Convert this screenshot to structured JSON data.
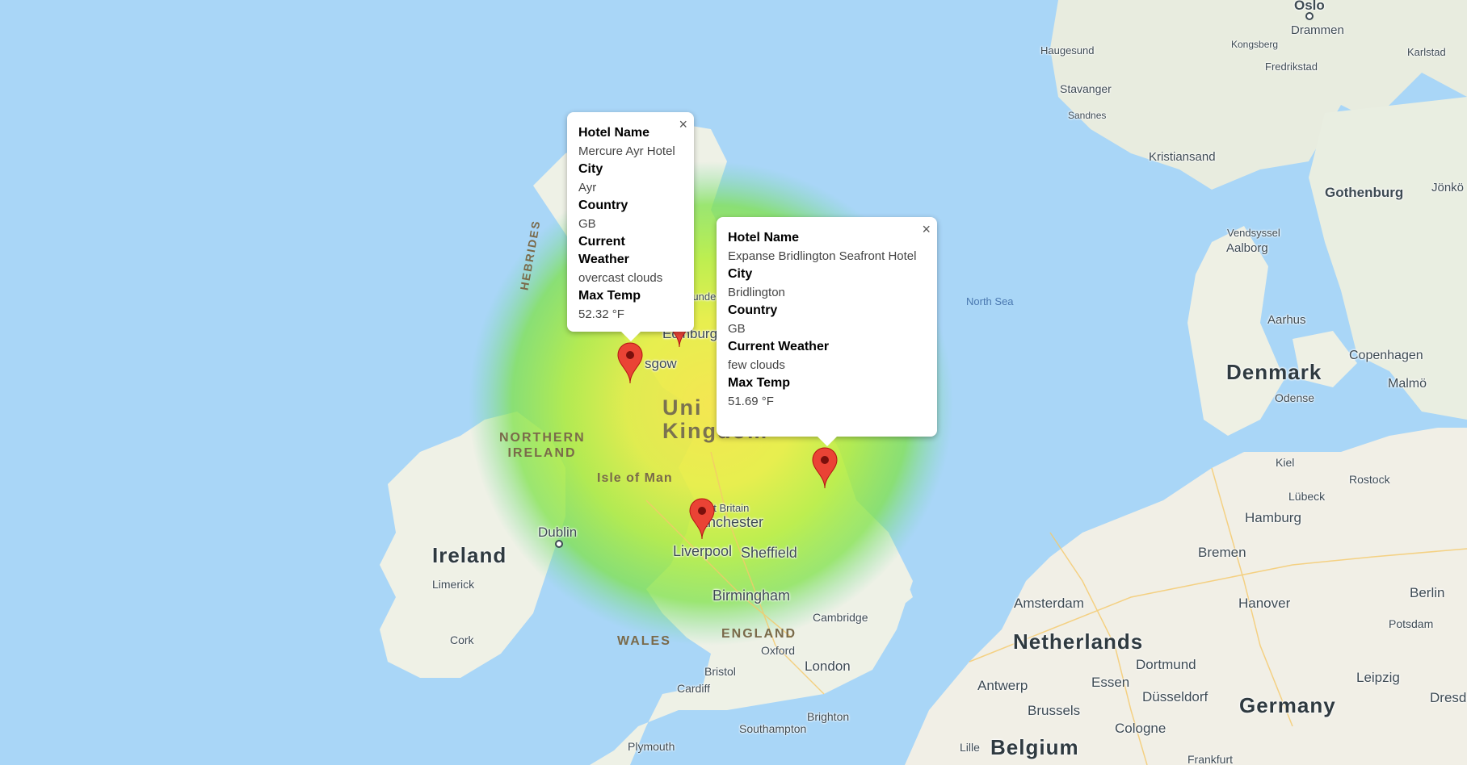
{
  "map": {
    "places": {
      "oslo": "Oslo",
      "drammen": "Drammen",
      "haugesund": "Haugesund",
      "kongsberg": "Kongsberg",
      "karlstad": "Karlstad",
      "fredrikstad": "Fredrikstad",
      "stavanger": "Stavanger",
      "sandnes": "Sandnes",
      "kristiansand": "Kristiansand",
      "gothenburg": "Gothenburg",
      "jonkoping": "Jönkö",
      "vendsyssel": "Vendsyssel",
      "aalborg": "Aalborg",
      "north_sea": "North Sea",
      "aarhus": "Aarhus",
      "denmark": "Denmark",
      "copenhagen": "Copenhagen",
      "malmo": "Malmö",
      "odense": "Odense",
      "kiel": "Kiel",
      "rostock": "Rostock",
      "lubeck": "Lübeck",
      "hamburg": "Hamburg",
      "bremen": "Bremen",
      "amsterdam": "Amsterdam",
      "hanover": "Hanover",
      "berlin": "Berlin",
      "potsdam": "Potsdam",
      "netherlands": "Netherlands",
      "dortmund": "Dortmund",
      "antwerp": "Antwerp",
      "essen": "Essen",
      "dusseldorf": "Düsseldorf",
      "leipzig": "Leipzig",
      "brussels": "Brussels",
      "cologne": "Cologne",
      "germany": "Germany",
      "dresden": "Dresden",
      "belgium": "Belgium",
      "lille": "Lille",
      "frankfurt": "Frankfurt",
      "hebrides": "HEBRIDES",
      "edinburgh": "Edinburgh",
      "dundee": "Dunde",
      "glasgow": "sgow",
      "uk_line1": "Uni",
      "uk_line2": "Kingdom",
      "northern_ireland": "NORTHERN IRELAND",
      "isle_of_man": "Isle of Man",
      "great_britain": "at Britain",
      "manchester": "anchester",
      "liverpool": "Liverpool",
      "sheffield": "Sheffield",
      "dublin": "Dublin",
      "ireland": "Ireland",
      "limerick": "Limerick",
      "cork": "Cork",
      "birmingham": "Birmingham",
      "cambridge": "Cambridge",
      "wales": "WALES",
      "england": "ENGLAND",
      "oxford": "Oxford",
      "bristol": "Bristol",
      "london": "London",
      "cardiff": "Cardiff",
      "brighton": "Brighton",
      "southampton": "Southampton",
      "plymouth": "Plymouth"
    },
    "heatmap_colors": [
      "#f2e94a",
      "#c8f03a",
      "#8de642",
      "#5fd68a"
    ],
    "marker_color": "#ea4335"
  },
  "popups": [
    {
      "close_glyph": "×",
      "fields": [
        {
          "label": "Hotel Name",
          "value": "Mercure Ayr Hotel"
        },
        {
          "label": "City",
          "value": "Ayr"
        },
        {
          "label": "Country",
          "value": "GB"
        },
        {
          "label": "Current Weather",
          "value": "overcast clouds"
        },
        {
          "label": "Max Temp",
          "value": "52.32 °F"
        }
      ]
    },
    {
      "close_glyph": "×",
      "fields": [
        {
          "label": "Hotel Name",
          "value": "Expanse Bridlington Seafront Hotel"
        },
        {
          "label": "City",
          "value": "Bridlington"
        },
        {
          "label": "Country",
          "value": "GB"
        },
        {
          "label": "Current Weather",
          "value": "few clouds"
        },
        {
          "label": "Max Temp",
          "value": "51.69 °F"
        }
      ]
    }
  ]
}
